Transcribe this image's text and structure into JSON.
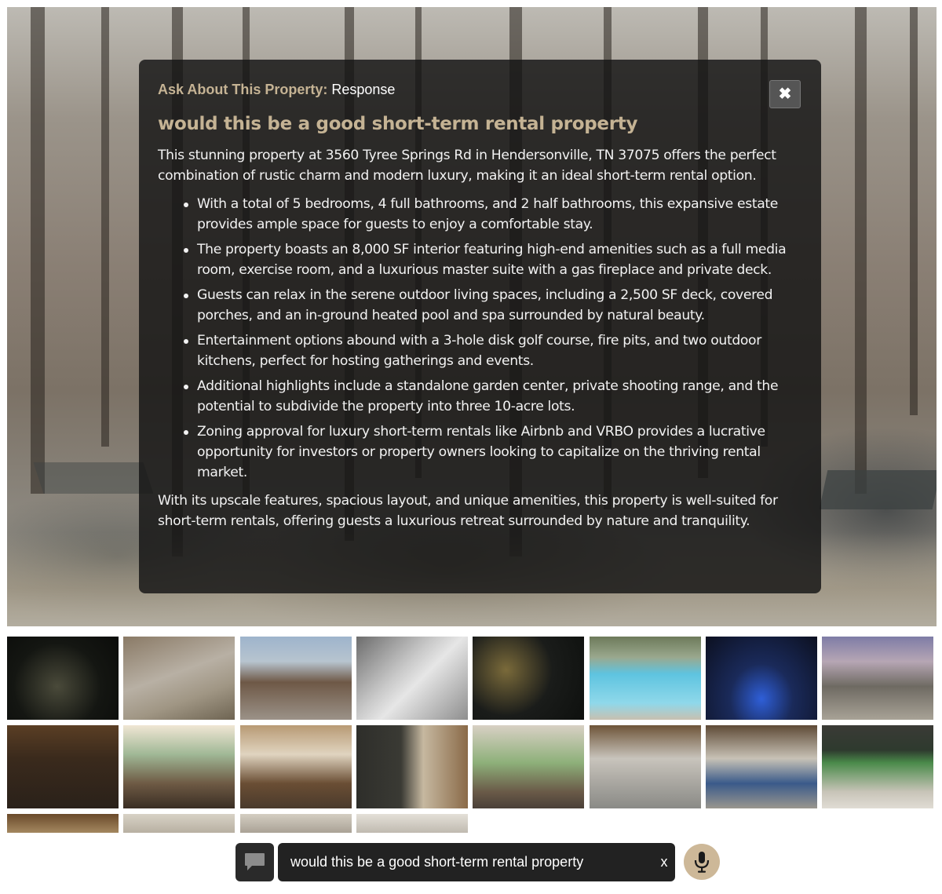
{
  "panel": {
    "label": "Ask About This Property:",
    "label_suffix": "Response",
    "close_glyph": "✖",
    "question": "would this be a good short-term rental property",
    "intro": "This stunning property at 3560 Tyree Springs Rd in Hendersonville, TN 37075 offers the perfect combination of rustic charm and modern luxury, making it an ideal short-term rental option.",
    "bullets": [
      "With a total of 5 bedrooms, 4 full bathrooms, and 2 half bathrooms, this expansive estate provides ample space for guests to enjoy a comfortable stay.",
      "The property boasts an 8,000 SF interior featuring high-end amenities such as a full media room, exercise room, and a luxurious master suite with a gas fireplace and private deck.",
      "Guests can relax in the serene outdoor living spaces, including a 2,500 SF deck, covered porches, and an in-ground heated pool and spa surrounded by natural beauty.",
      "Entertainment options abound with a 3-hole disk golf course, fire pits, and two outdoor kitchens, perfect for hosting gatherings and events.",
      "Additional highlights include a standalone garden center, private shooting range, and the potential to subdivide the property into three 10-acre lots.",
      "Zoning approval for luxury short-term rentals like Airbnb and VRBO provides a lucrative opportunity for investors or property owners looking to capitalize on the thriving rental market."
    ],
    "outro": "With its upscale features, spacious layout, and unique amenities, this property is well-suited for short-term rentals, offering guests a luxurious retreat surrounded by nature and tranquility."
  },
  "ask_bar": {
    "chat_icon": "chat-bubble-icon",
    "input_value": "would this be a good short-term rental property",
    "clear_glyph": "x",
    "mic_icon": "microphone-icon"
  },
  "colors": {
    "accent": "#c5b394",
    "panel_bg": "#141414",
    "mic_bg": "#cdb898",
    "input_bg": "#222222"
  }
}
